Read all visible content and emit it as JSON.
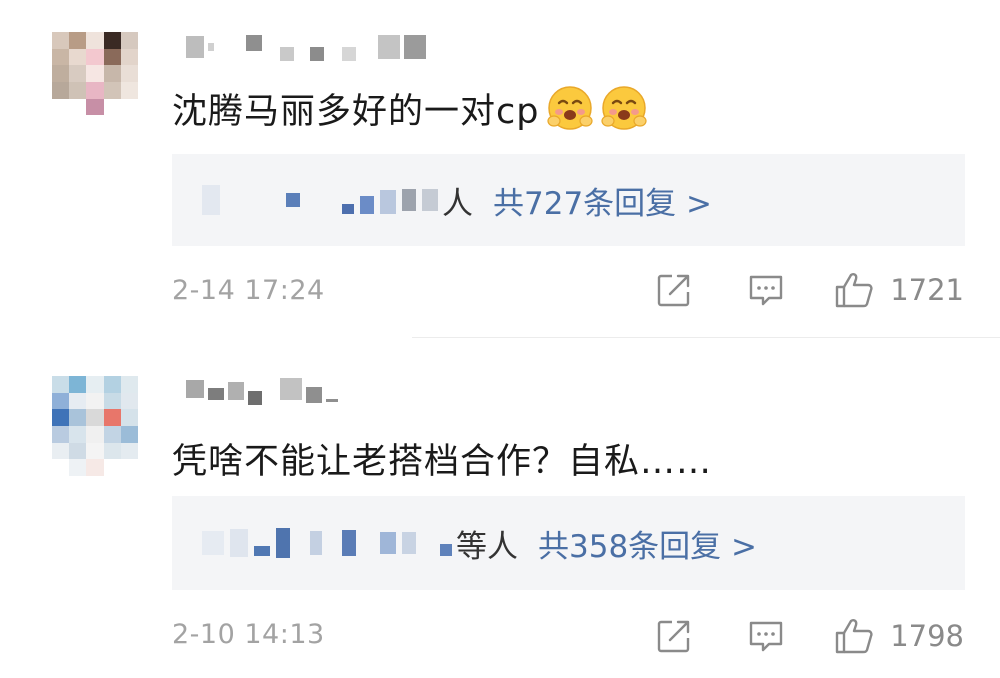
{
  "colors": {
    "link": "#4a6fa5",
    "meta": "#a3a3a3",
    "reply_bg": "#f4f5f7"
  },
  "comments": [
    {
      "text": "沈腾马丽多好的一对cp",
      "emoji": [
        "blush-hug-emoji",
        "blush-hug-emoji"
      ],
      "reply_suffix": "人",
      "reply_count": "共727条回复 >",
      "timestamp": "2-14 17:24",
      "likes": "1721"
    },
    {
      "text": "凭啥不能让老搭档合作？自私……",
      "emoji": [],
      "reply_suffix": "等人",
      "reply_count": "共358条回复 >",
      "timestamp": "2-10 14:13",
      "likes": "1798"
    }
  ],
  "icons": {
    "share": "share-icon",
    "reply": "comment-icon",
    "like": "thumbs-up-icon"
  }
}
